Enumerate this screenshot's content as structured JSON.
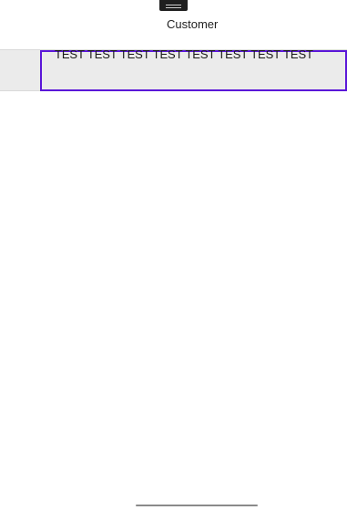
{
  "header": {
    "title": "Customer",
    "handle_icon": "menu-handle-icon"
  },
  "field": {
    "value": "TEST TEST TEST TEST TEST TEST TEST TEST",
    "accent_color": "#5a16d8"
  },
  "colors": {
    "row_background": "#ebebeb",
    "page_background": "#ffffff"
  }
}
